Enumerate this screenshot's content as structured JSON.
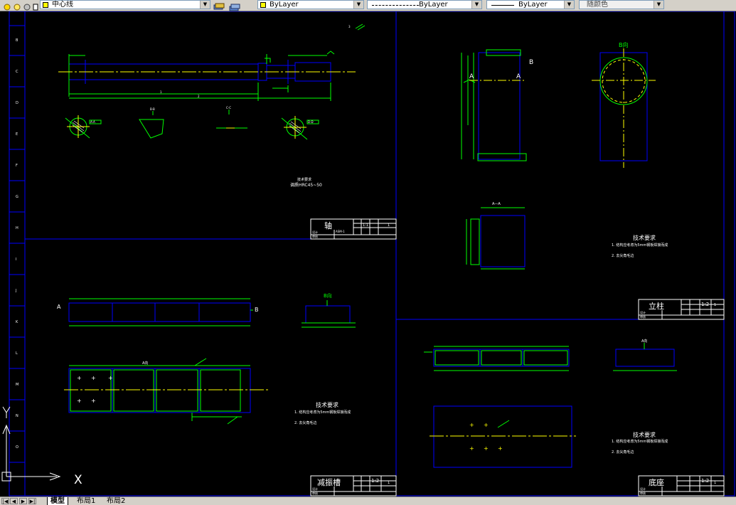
{
  "toolbar": {
    "layer_name": "中心线",
    "color_value": "ByLayer",
    "linetype_value": "ByLayer",
    "lineweight_value": "ByLayer",
    "plotstyle_value": "随颜色"
  },
  "colors": {
    "frame": "#0000ff",
    "drawing": "#00ff00",
    "centerline": "#ffff00",
    "text": "#ffffff",
    "toolbar_bg": "#d4d0c8"
  },
  "border": {
    "row_labels": [
      "B",
      "C",
      "D",
      "E",
      "F",
      "G",
      "H",
      "I",
      "J",
      "K",
      "L",
      "M",
      "N",
      "O"
    ]
  },
  "sheet_shaft": {
    "view_labels": [
      "A-A",
      "B-B",
      "C-C",
      "D-D"
    ],
    "tech_title": "技术要求",
    "tech_note": "调质HRC45~50",
    "title_block": {
      "name": "轴",
      "scale": "1:1",
      "qty": "1",
      "drawn": "设计",
      "checked": "审核",
      "code": "ASM-1"
    }
  },
  "sheet_column": {
    "section_label": "B向",
    "view_label": "A—A",
    "tech_title": "技术要求",
    "tech_notes": [
      "1.   结构应考虑为5mm钢板焊接而成",
      "2.   去尖角毛边"
    ],
    "title_block": {
      "name": "立柱",
      "scale": "1:2",
      "qty": "1",
      "drawn": "设计",
      "checked": "审核"
    }
  },
  "sheet_damper": {
    "section_label": "B向",
    "view_label": "A向",
    "tech_title": "技术要求",
    "tech_notes": [
      "1.   结构应考虑为5mm钢板焊接而成",
      "2.   去尖角毛边"
    ],
    "title_block": {
      "name": "减振槽",
      "scale": "1:2",
      "qty": "1",
      "drawn": "设计",
      "checked": "审核"
    }
  },
  "sheet_base": {
    "view_label": "A向",
    "tech_title": "技术要求",
    "tech_notes": [
      "1.   结构应考虑为5mm钢板焊接而成",
      "2.   去尖角毛边"
    ],
    "title_block": {
      "name": "底座",
      "scale": "1:2",
      "qty": "1",
      "drawn": "设计",
      "checked": "审核"
    }
  },
  "ucs": {
    "x_label": "X",
    "y_label": "Y"
  },
  "tabs": [
    {
      "label": "模型",
      "active": true
    },
    {
      "label": "布局1",
      "active": false
    },
    {
      "label": "布局2",
      "active": false
    }
  ]
}
